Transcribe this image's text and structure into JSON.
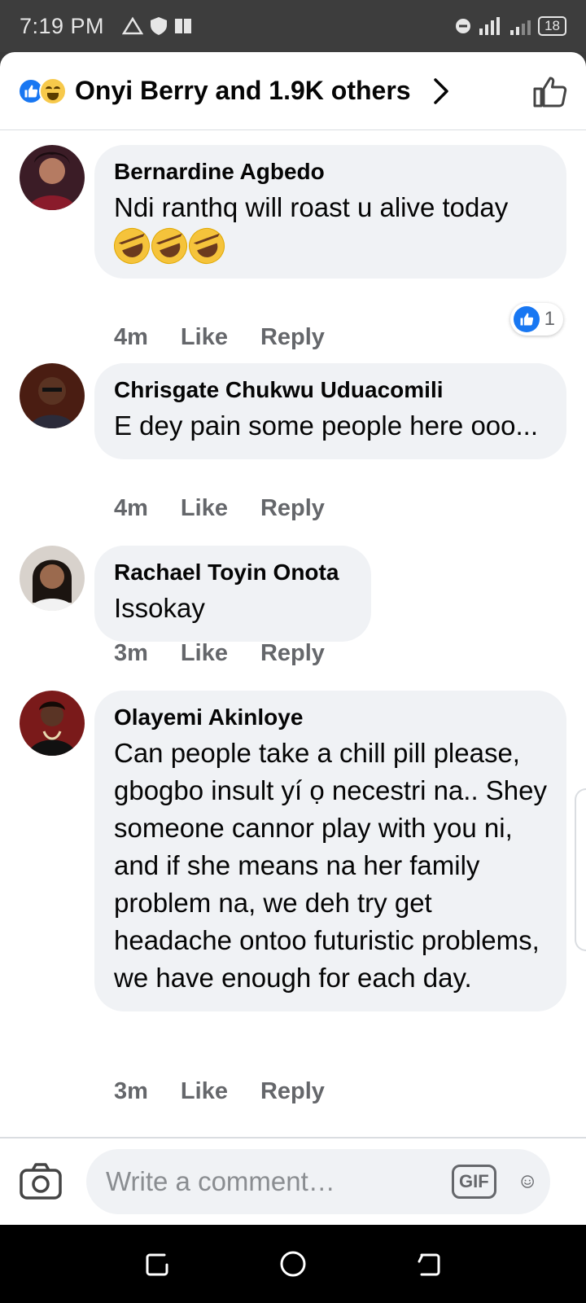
{
  "status_bar": {
    "time": "7:19 PM",
    "battery": "18",
    "icons": [
      "alert-triangle-icon",
      "shield-icon",
      "sim-icon",
      "dnd-icon",
      "signal-icon",
      "wifi-icon",
      "battery-icon"
    ]
  },
  "header": {
    "reactions_label": "Onyi Berry and 1.9K others",
    "reaction_icons": [
      "like-reaction-icon",
      "haha-reaction-icon"
    ],
    "accent_color": "#1877f2"
  },
  "comments": [
    {
      "author": "Bernardine Agbedo",
      "text": "Ndi ranthq will roast u alive today",
      "emojis": [
        "rofl-emoji",
        "rofl-emoji",
        "rofl-emoji"
      ],
      "time": "4m",
      "like_label": "Like",
      "reply_label": "Reply",
      "reaction_count": "1"
    },
    {
      "author": "Chrisgate Chukwu Uduacomili",
      "text": "E dey pain some people here ooo...",
      "time": "4m",
      "like_label": "Like",
      "reply_label": "Reply"
    },
    {
      "author": "Rachael Toyin Onota",
      "text": "Issokay",
      "time": "3m",
      "like_label": "Like",
      "reply_label": "Reply"
    },
    {
      "author": "Olayemi Akinloye",
      "text": "Can people take a chill pill please, gbogbo insult yí ọ necestri na.. Shey someone cannor play with you ni, and if she means na her family problem na, we deh try get headache ontoo futuristic problems, we have enough for each day.",
      "time": "3m",
      "like_label": "Like",
      "reply_label": "Reply"
    }
  ],
  "composer": {
    "placeholder": "Write a comment…",
    "gif_label": "GIF"
  }
}
